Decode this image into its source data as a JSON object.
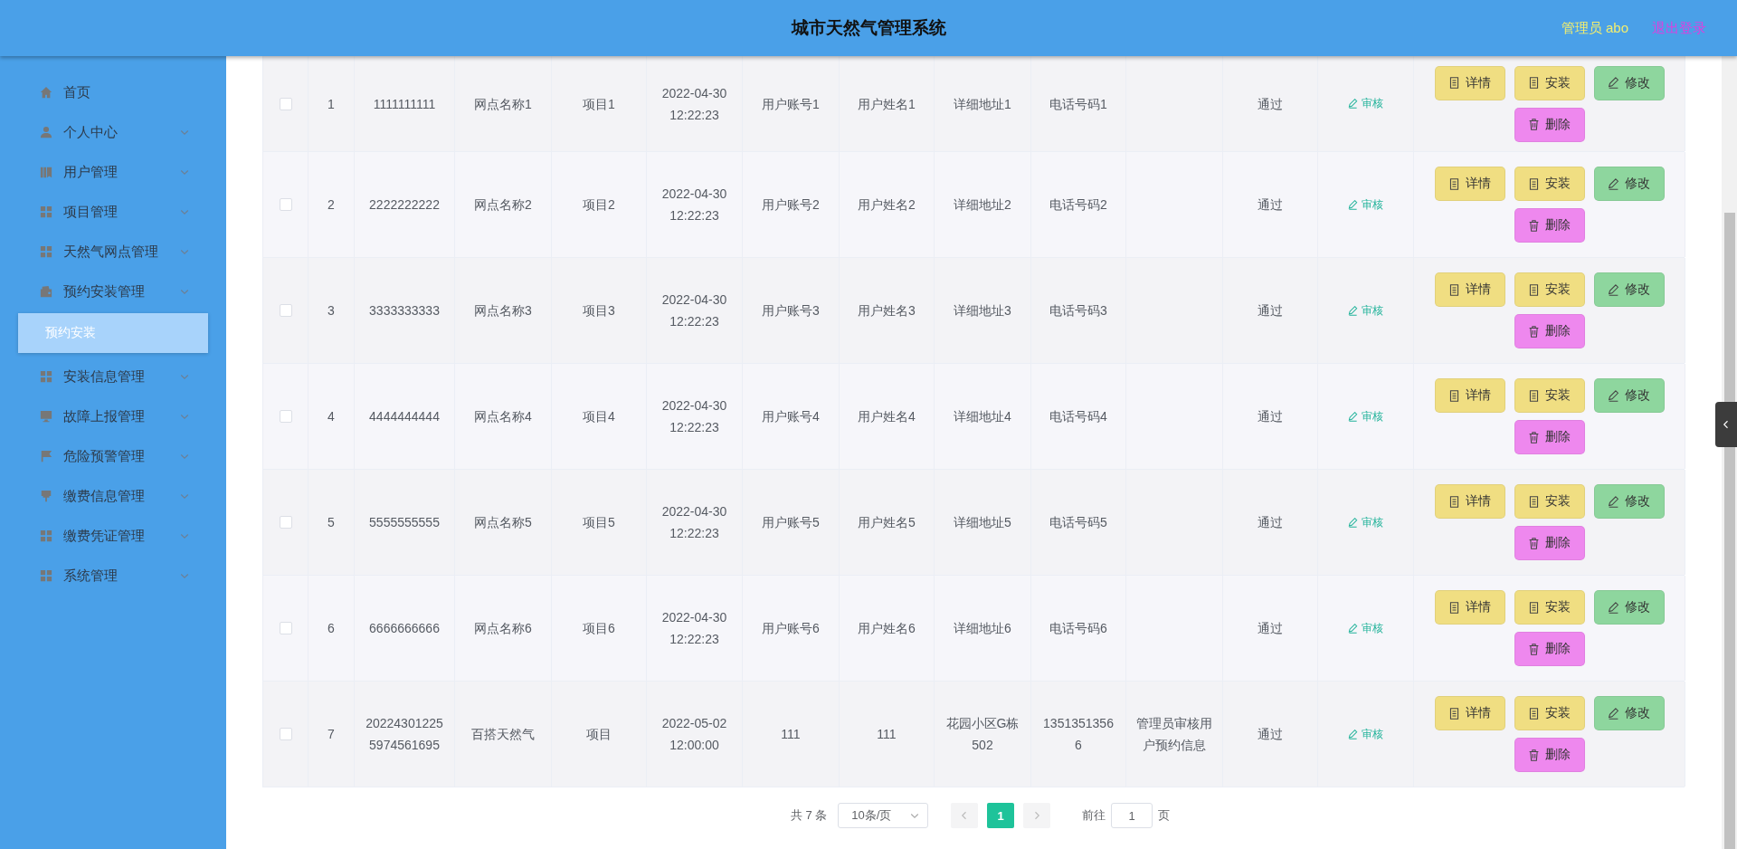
{
  "header": {
    "title": "城市天然气管理系统",
    "user": "管理员 abo",
    "logout": "退出登录"
  },
  "sidebar": {
    "items": [
      {
        "label": "首页",
        "kind": "home",
        "expandable": false
      },
      {
        "label": "个人中心",
        "kind": "user",
        "expandable": true
      },
      {
        "label": "用户管理",
        "kind": "books",
        "expandable": true
      },
      {
        "label": "项目管理",
        "kind": "grid",
        "expandable": true
      },
      {
        "label": "天然气网点管理",
        "kind": "grid",
        "expandable": true
      },
      {
        "label": "预约安装管理",
        "kind": "wallet",
        "expandable": true,
        "children": [
          {
            "label": "预约安装",
            "selected": true
          }
        ]
      },
      {
        "label": "安装信息管理",
        "kind": "grid",
        "expandable": true
      },
      {
        "label": "故障上报管理",
        "kind": "monitor",
        "expandable": true
      },
      {
        "label": "危险预警管理",
        "kind": "flag",
        "expandable": true
      },
      {
        "label": "缴费信息管理",
        "kind": "brush",
        "expandable": true
      },
      {
        "label": "缴费凭证管理",
        "kind": "grid",
        "expandable": true
      },
      {
        "label": "系统管理",
        "kind": "grid",
        "expandable": true
      }
    ]
  },
  "table": {
    "rows": [
      {
        "checked": false,
        "cells": [
          "1",
          "1111111111",
          "网点名称1",
          "项目1",
          "2022-04-30 12:22:23",
          "用户账号1",
          "用户姓名1",
          "详细地址1",
          "电话号码1",
          "",
          "通过"
        ],
        "review": "审核",
        "actions": [
          {
            "label": "详情",
            "kind": "detail"
          },
          {
            "label": "安装",
            "kind": "install"
          },
          {
            "label": "修改",
            "kind": "edit"
          },
          {
            "label": "删除",
            "kind": "delete"
          }
        ]
      },
      {
        "checked": false,
        "cells": [
          "2",
          "2222222222",
          "网点名称2",
          "项目2",
          "2022-04-30 12:22:23",
          "用户账号2",
          "用户姓名2",
          "详细地址2",
          "电话号码2",
          "",
          "通过"
        ],
        "review": "审核",
        "actions": [
          {
            "label": "详情",
            "kind": "detail"
          },
          {
            "label": "安装",
            "kind": "install"
          },
          {
            "label": "修改",
            "kind": "edit"
          },
          {
            "label": "删除",
            "kind": "delete"
          }
        ]
      },
      {
        "checked": false,
        "cells": [
          "3",
          "3333333333",
          "网点名称3",
          "项目3",
          "2022-04-30 12:22:23",
          "用户账号3",
          "用户姓名3",
          "详细地址3",
          "电话号码3",
          "",
          "通过"
        ],
        "review": "审核",
        "actions": [
          {
            "label": "详情",
            "kind": "detail"
          },
          {
            "label": "安装",
            "kind": "install"
          },
          {
            "label": "修改",
            "kind": "edit"
          },
          {
            "label": "删除",
            "kind": "delete"
          }
        ]
      },
      {
        "checked": false,
        "cells": [
          "4",
          "4444444444",
          "网点名称4",
          "项目4",
          "2022-04-30 12:22:23",
          "用户账号4",
          "用户姓名4",
          "详细地址4",
          "电话号码4",
          "",
          "通过"
        ],
        "review": "审核",
        "actions": [
          {
            "label": "详情",
            "kind": "detail"
          },
          {
            "label": "安装",
            "kind": "install"
          },
          {
            "label": "修改",
            "kind": "edit"
          },
          {
            "label": "删除",
            "kind": "delete"
          }
        ]
      },
      {
        "checked": false,
        "cells": [
          "5",
          "5555555555",
          "网点名称5",
          "项目5",
          "2022-04-30 12:22:23",
          "用户账号5",
          "用户姓名5",
          "详细地址5",
          "电话号码5",
          "",
          "通过"
        ],
        "review": "审核",
        "actions": [
          {
            "label": "详情",
            "kind": "detail"
          },
          {
            "label": "安装",
            "kind": "install"
          },
          {
            "label": "修改",
            "kind": "edit"
          },
          {
            "label": "删除",
            "kind": "delete"
          }
        ]
      },
      {
        "checked": false,
        "cells": [
          "6",
          "6666666666",
          "网点名称6",
          "项目6",
          "2022-04-30 12:22:23",
          "用户账号6",
          "用户姓名6",
          "详细地址6",
          "电话号码6",
          "",
          "通过"
        ],
        "review": "审核",
        "actions": [
          {
            "label": "详情",
            "kind": "detail"
          },
          {
            "label": "安装",
            "kind": "install"
          },
          {
            "label": "修改",
            "kind": "edit"
          },
          {
            "label": "删除",
            "kind": "delete"
          }
        ]
      },
      {
        "checked": false,
        "cells": [
          "7",
          "202243012255974561695",
          "百搭天然气",
          "项目",
          "2022-05-02 12:00:00",
          "111",
          "111",
          "花园小区G栋502",
          "13513513566",
          "管理员审核用户预约信息",
          "通过"
        ],
        "review": "审核",
        "actions": [
          {
            "label": "详情",
            "kind": "detail"
          },
          {
            "label": "安装",
            "kind": "install"
          },
          {
            "label": "修改",
            "kind": "edit"
          },
          {
            "label": "删除",
            "kind": "delete"
          }
        ]
      }
    ]
  },
  "pagination": {
    "total": "共 7 条",
    "page_size": "10条/页",
    "pages": [
      {
        "label": "1",
        "selected": true
      }
    ],
    "goto_label": "前往",
    "goto_value": "1",
    "goto_suffix": "页"
  }
}
